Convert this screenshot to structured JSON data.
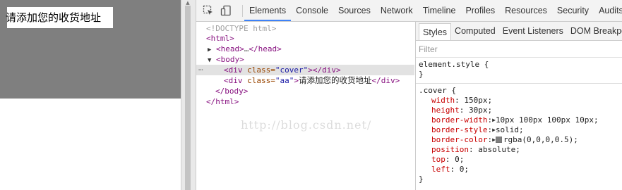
{
  "page": {
    "aa_text": "请添加您的收货地址"
  },
  "devtools": {
    "tabs": [
      "Elements",
      "Console",
      "Sources",
      "Network",
      "Timeline",
      "Profiles",
      "Resources",
      "Security",
      "Audits"
    ],
    "active_tab": "Elements",
    "dom": {
      "doctype": "<!DOCTYPE html>",
      "html_open": "<html>",
      "head_open": "<head>",
      "head_dots": "…",
      "head_close": "</head>",
      "body_open": "<body>",
      "cover_div_open": "<div",
      "cover_attr": " class=",
      "cover_val": "\"cover\"",
      "cover_gt": ">",
      "cover_div_close": "</div>",
      "aa_div_open": "<div",
      "aa_attr": " class=",
      "aa_val": "\"aa\"",
      "aa_gt": ">",
      "aa_text": "请添加您的收货地址",
      "aa_div_close": "</div>",
      "body_close": "</body>",
      "html_close": "</html>",
      "selected_marker": "…"
    },
    "watermark": "http://blog.csdn.net/",
    "sidebar": {
      "tabs": [
        "Styles",
        "Computed",
        "Event Listeners",
        "DOM Breakpoints"
      ],
      "active_tab": "Styles",
      "filter_placeholder": "Filter",
      "element_style": {
        "selector": "element.style {",
        "close": "}"
      },
      "cover_rule": {
        "selector": ".cover {",
        "close": "}",
        "props": [
          {
            "name": "width",
            "value": "150px;"
          },
          {
            "name": "height",
            "value": "30px;"
          },
          {
            "name": "border-width",
            "value": "10px 100px 100px 10px;",
            "expandable": true
          },
          {
            "name": "border-style",
            "value": "solid;",
            "expandable": true
          },
          {
            "name": "border-color",
            "value": "rgba(0,0,0,0.5);",
            "expandable": true,
            "swatch": true
          },
          {
            "name": "position",
            "value": "absolute;"
          },
          {
            "name": "top",
            "value": "0;"
          },
          {
            "name": "left",
            "value": "0;"
          }
        ]
      }
    }
  },
  "colors": {
    "accent_tab": "#3e82f7",
    "tag": "#881280",
    "attr": "#994500",
    "attr_value": "#1a1aa6",
    "css_prop": "#c80000"
  },
  "icons": [
    "inspect-element-icon",
    "device-mode-icon"
  ]
}
